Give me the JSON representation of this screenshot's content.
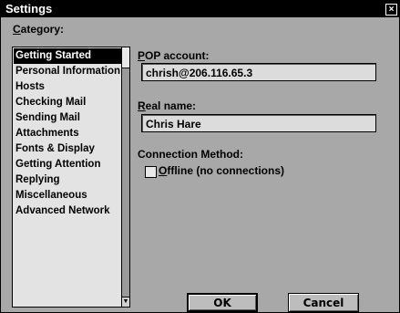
{
  "window": {
    "title": "Settings",
    "close_symbol": "×"
  },
  "category": {
    "label_first": "C",
    "label_rest": "ategory:",
    "items": [
      "Getting Started",
      "Personal Information",
      "Hosts",
      "Checking Mail",
      "Sending Mail",
      "Attachments",
      "Fonts & Display",
      "Getting Attention",
      "Replying",
      "Miscellaneous",
      "Advanced Network"
    ],
    "selected_index": 0
  },
  "pop": {
    "label_first": "P",
    "label_rest": "OP account:",
    "value": "chrish@206.116.65.3"
  },
  "realname": {
    "label_first": "R",
    "label_rest": "eal name:",
    "value": "Chris Hare"
  },
  "connection": {
    "label": "Connection Method:",
    "offline_first": "O",
    "offline_rest": "ffline (no connections)",
    "offline_checked": false
  },
  "buttons": {
    "ok": "OK",
    "cancel": "Cancel"
  }
}
